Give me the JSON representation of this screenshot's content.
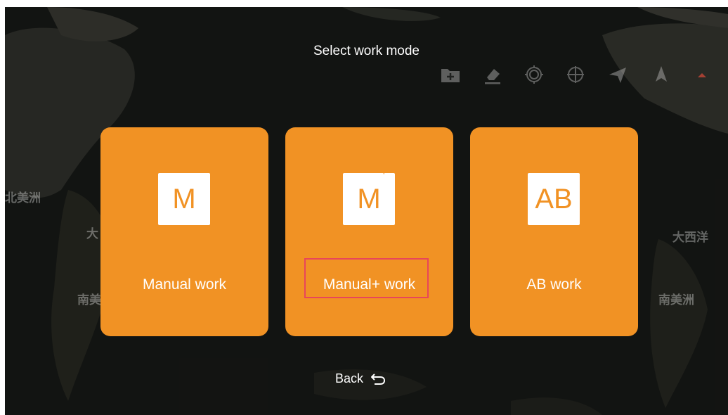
{
  "dialog": {
    "title": "Select work mode"
  },
  "map_labels": [
    "北美洲",
    "大",
    "南美",
    "大西洋",
    "南美洲"
  ],
  "toolbar_icons": [
    "add-folder-icon",
    "eraser-icon",
    "home-point-icon",
    "locate-icon",
    "send-icon",
    "navigate-icon"
  ],
  "modes": [
    {
      "icon_text": "M",
      "icon_sup": "",
      "label": "Manual work"
    },
    {
      "icon_text": "M",
      "icon_sup": "+",
      "label": "Manual+ work",
      "highlighted": true
    },
    {
      "icon_text": "AB",
      "icon_sup": "",
      "label": "AB work"
    }
  ],
  "back": {
    "label": "Back"
  },
  "colors": {
    "card": "#f19224",
    "highlight_border": "#e8465a",
    "background": "#1a1a1a"
  }
}
